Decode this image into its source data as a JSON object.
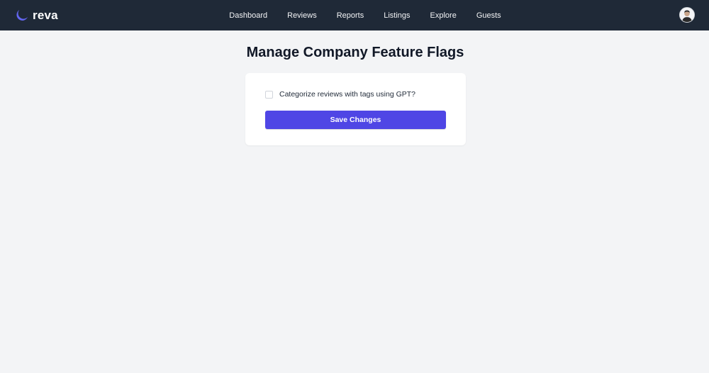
{
  "brand": {
    "name": "reva",
    "accent": "#6366f1"
  },
  "nav": {
    "items": [
      {
        "label": "Dashboard"
      },
      {
        "label": "Reviews"
      },
      {
        "label": "Reports"
      },
      {
        "label": "Listings"
      },
      {
        "label": "Explore"
      },
      {
        "label": "Guests"
      }
    ]
  },
  "user": {
    "avatar_icon": "user-avatar"
  },
  "page": {
    "title": "Manage Company Feature Flags"
  },
  "flags": [
    {
      "label": "Categorize reviews with tags using GPT?",
      "checked": false
    }
  ],
  "actions": {
    "save_label": "Save Changes"
  },
  "colors": {
    "navbar": "#1f2937",
    "primary_button": "#4f46e5",
    "background": "#f3f4f6"
  }
}
